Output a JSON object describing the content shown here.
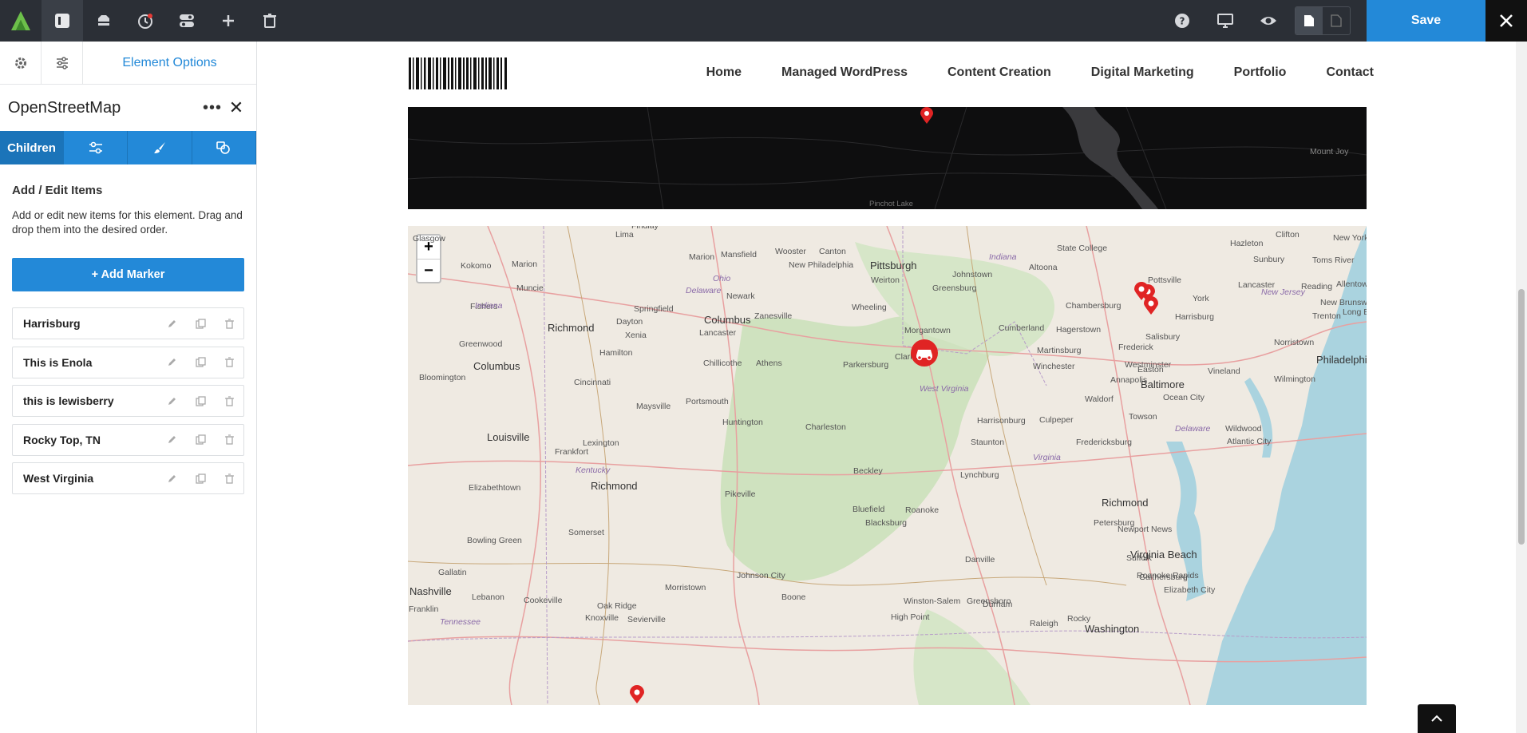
{
  "toolbar": {
    "save_label": "Save",
    "icons": [
      "logo",
      "layout-icon",
      "database-icon",
      "history-icon",
      "toggle-icon",
      "plus-icon",
      "trash-icon"
    ],
    "right_icons": [
      "help-icon",
      "desktop-icon",
      "eye-icon",
      "page-icon",
      "page-outline-icon",
      "close-icon"
    ]
  },
  "sidebar": {
    "tab_label": "Element Options",
    "element_title": "OpenStreetMap",
    "subtabs": {
      "children": "Children"
    },
    "section_title": "Add / Edit Items",
    "section_desc": "Add or edit new items for this element. Drag and drop them into the desired order.",
    "add_button": "+ Add Marker",
    "items": [
      {
        "label": "Harrisburg"
      },
      {
        "label": "This is Enola"
      },
      {
        "label": "this is lewisberry"
      },
      {
        "label": "Rocky Top, TN"
      },
      {
        "label": "West Virginia"
      }
    ]
  },
  "site": {
    "nav": [
      "Home",
      "Managed WordPress",
      "Content Creation",
      "Digital Marketing",
      "Portfolio",
      "Contact"
    ]
  },
  "map_dark": {
    "labels": [
      "Mount Joy",
      "Pinchot Lake"
    ]
  },
  "map": {
    "zoom_in": "+",
    "zoom_out": "−",
    "labels": [
      "Glasgow",
      "Kokomo",
      "Marion",
      "Fishers",
      "Muncie",
      "Indiana",
      "Richmond",
      "Greenwood",
      "Columbus",
      "Bloomington",
      "Lima",
      "Findlay",
      "Marion",
      "Mansfield",
      "Wooster",
      "Canton",
      "New Philadelphia",
      "Delaware",
      "Ohio",
      "Springfield",
      "Columbus",
      "Dayton",
      "Xenia",
      "Hamilton",
      "Cincinnati",
      "Lancaster",
      "Newark",
      "Zanesville",
      "Chillicothe",
      "Athens",
      "Portsmouth",
      "Maysville",
      "Huntington",
      "Louisville",
      "Frankfort",
      "Lexington",
      "Kentucky",
      "Richmond",
      "Elizabethtown",
      "Somerset",
      "Bowling Green",
      "Gallatin",
      "Nashville",
      "Lebanon",
      "Cookeville",
      "Franklin",
      "Tennessee",
      "Oak Ridge",
      "Knoxville",
      "Sevierville",
      "Morristown",
      "Johnson City",
      "Boone",
      "Pittsburgh",
      "Weirton",
      "Wheeling",
      "Greensburg",
      "Johnstown",
      "Indiana",
      "Altoona",
      "State College",
      "Morgantown",
      "Clarksburg",
      "Parkersburg",
      "West Virginia",
      "Charleston",
      "Beckley",
      "Pikeville",
      "Bluefield",
      "Roanoke",
      "Blacksburg",
      "Lynchburg",
      "Danville",
      "Winston-Salem",
      "Greensboro",
      "High Point",
      "Durham",
      "Raleigh",
      "Rocky",
      "Cumberland",
      "Hagerstown",
      "Martinsburg",
      "Winchester",
      "Frederick",
      "Chambersburg",
      "Harrisonburg",
      "Staunton",
      "Culpeper",
      "Virginia",
      "Fredericksburg",
      "Richmond",
      "Petersburg",
      "Newport News",
      "Virginia Beach",
      "Suffolk",
      "Elizabeth City",
      "Roanoke Rapids",
      "Gaithersburg",
      "Washington",
      "Annapolis",
      "Waldorf",
      "Baltimore",
      "Towson",
      "Westminster",
      "Easton",
      "Salisbury",
      "Ocean City",
      "Delaware",
      "Wildwood",
      "Atlantic City",
      "Vineland",
      "Wilmington",
      "Philadelphia",
      "Norristown",
      "Trenton",
      "New Jersey",
      "New Brunswick",
      "Long Branch",
      "Toms River",
      "Allentown",
      "Reading",
      "Lancaster",
      "York",
      "Harrisburg",
      "Pottsville",
      "Sunbury",
      "Hazleton",
      "Clifton",
      "New York"
    ]
  }
}
